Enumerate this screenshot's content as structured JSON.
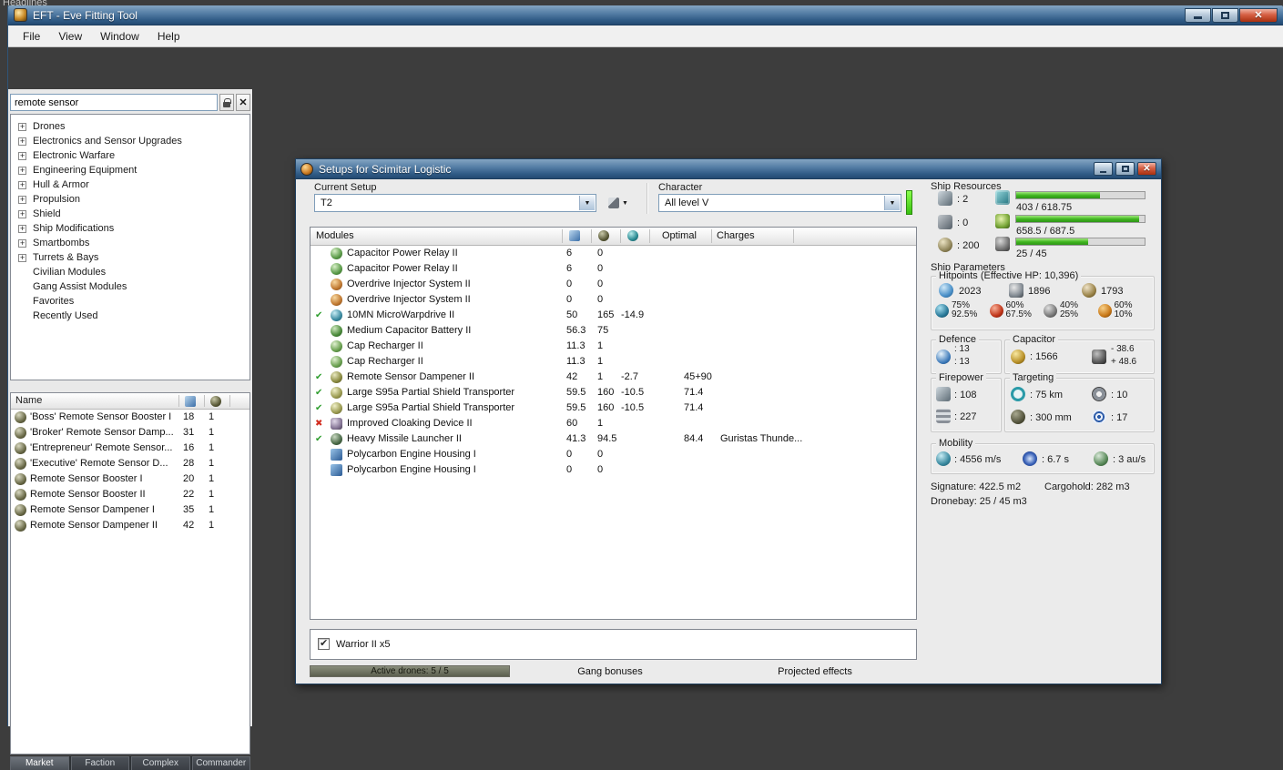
{
  "desktop": {
    "headlines": "Headlines"
  },
  "window": {
    "title": "EFT - Eve Fitting Tool",
    "menu": [
      {
        "label": "File"
      },
      {
        "label": "View"
      },
      {
        "label": "Window"
      },
      {
        "label": "Help"
      }
    ]
  },
  "sidebar": {
    "search": {
      "value": "remote sensor"
    },
    "tree": [
      {
        "label": "Drones",
        "expandable": true
      },
      {
        "label": "Electronics and Sensor Upgrades",
        "expandable": true
      },
      {
        "label": "Electronic Warfare",
        "expandable": true
      },
      {
        "label": "Engineering Equipment",
        "expandable": true
      },
      {
        "label": "Hull & Armor",
        "expandable": true
      },
      {
        "label": "Propulsion",
        "expandable": true
      },
      {
        "label": "Shield",
        "expandable": true
      },
      {
        "label": "Ship Modifications",
        "expandable": true
      },
      {
        "label": "Smartbombs",
        "expandable": true
      },
      {
        "label": "Turrets & Bays",
        "expandable": true
      },
      {
        "label": "Civilian Modules",
        "expandable": false
      },
      {
        "label": "Gang Assist Modules",
        "expandable": false
      },
      {
        "label": "Favorites",
        "expandable": false
      },
      {
        "label": "Recently Used",
        "expandable": false
      }
    ],
    "results": {
      "name_header": "Name",
      "rows": [
        {
          "name": "'Boss' Remote Sensor Booster I",
          "cpu": "18",
          "pg": "1"
        },
        {
          "name": "'Broker' Remote Sensor Damp...",
          "cpu": "31",
          "pg": "1"
        },
        {
          "name": "'Entrepreneur' Remote Sensor...",
          "cpu": "16",
          "pg": "1"
        },
        {
          "name": "'Executive' Remote Sensor D...",
          "cpu": "28",
          "pg": "1"
        },
        {
          "name": "Remote Sensor Booster I",
          "cpu": "20",
          "pg": "1"
        },
        {
          "name": "Remote Sensor Booster II",
          "cpu": "22",
          "pg": "1"
        },
        {
          "name": "Remote Sensor Dampener I",
          "cpu": "35",
          "pg": "1"
        },
        {
          "name": "Remote Sensor Dampener II",
          "cpu": "42",
          "pg": "1"
        }
      ]
    },
    "tabs": [
      {
        "label": "Market",
        "active": true
      },
      {
        "label": "Faction",
        "active": false
      },
      {
        "label": "Complex",
        "active": false
      },
      {
        "label": "Commander",
        "active": false
      }
    ]
  },
  "setup": {
    "title": "Setups for Scimitar Logistic",
    "current_setup_label": "Current Setup",
    "current_setup_value": "T2",
    "character_label": "Character",
    "character_value": "All level V",
    "columns": {
      "modules": "Modules",
      "optimal": "Optimal",
      "charges": "Charges"
    },
    "modules": [
      {
        "status": "none",
        "icon": "cap-relay",
        "name": "Capacitor Power Relay II",
        "pg": "6",
        "cpu": "0",
        "cap": "",
        "optimal": "",
        "charges": ""
      },
      {
        "status": "none",
        "icon": "cap-relay",
        "name": "Capacitor Power Relay II",
        "pg": "6",
        "cpu": "0",
        "cap": "",
        "optimal": "",
        "charges": ""
      },
      {
        "status": "none",
        "icon": "overdrive",
        "name": "Overdrive Injector System II",
        "pg": "0",
        "cpu": "0",
        "cap": "",
        "optimal": "",
        "charges": ""
      },
      {
        "status": "none",
        "icon": "overdrive",
        "name": "Overdrive Injector System II",
        "pg": "0",
        "cpu": "0",
        "cap": "",
        "optimal": "",
        "charges": ""
      },
      {
        "status": "active",
        "icon": "mwd",
        "name": "10MN MicroWarpdrive II",
        "pg": "50",
        "cpu": "165",
        "cap": "-14.9",
        "optimal": "",
        "charges": ""
      },
      {
        "status": "none",
        "icon": "cap-battery",
        "name": "Medium Capacitor Battery II",
        "pg": "56.3",
        "cpu": "75",
        "cap": "",
        "optimal": "",
        "charges": ""
      },
      {
        "status": "none",
        "icon": "cap-recharger",
        "name": "Cap Recharger II",
        "pg": "11.3",
        "cpu": "1",
        "cap": "",
        "optimal": "",
        "charges": ""
      },
      {
        "status": "none",
        "icon": "cap-recharger",
        "name": "Cap Recharger II",
        "pg": "11.3",
        "cpu": "1",
        "cap": "",
        "optimal": "",
        "charges": ""
      },
      {
        "status": "active",
        "icon": "sensor-damp",
        "name": "Remote Sensor Dampener II",
        "pg": "42",
        "cpu": "1",
        "cap": "-2.7",
        "optimal": "45+90",
        "charges": ""
      },
      {
        "status": "active",
        "icon": "shield-transporter",
        "name": "Large S95a Partial Shield Transporter",
        "pg": "59.5",
        "cpu": "160",
        "cap": "-10.5",
        "optimal": "71.4",
        "charges": ""
      },
      {
        "status": "active",
        "icon": "shield-transporter",
        "name": "Large S95a Partial Shield Transporter",
        "pg": "59.5",
        "cpu": "160",
        "cap": "-10.5",
        "optimal": "71.4",
        "charges": ""
      },
      {
        "status": "offline",
        "icon": "cloak",
        "name": "Improved Cloaking Device II",
        "pg": "60",
        "cpu": "1",
        "cap": "",
        "optimal": "",
        "charges": ""
      },
      {
        "status": "active",
        "icon": "missile-launcher",
        "name": "Heavy Missile Launcher II",
        "pg": "41.3",
        "cpu": "94.5",
        "cap": "",
        "optimal": "84.4",
        "charges": "Guristas Thunde..."
      },
      {
        "status": "none",
        "icon": "rig",
        "name": "Polycarbon Engine Housing I",
        "pg": "0",
        "cpu": "0",
        "cap": "",
        "optimal": "",
        "charges": ""
      },
      {
        "status": "none",
        "icon": "rig",
        "name": "Polycarbon Engine Housing I",
        "pg": "0",
        "cpu": "0",
        "cap": "",
        "optimal": "",
        "charges": ""
      }
    ],
    "drone_row": {
      "label": "Warrior II x5",
      "checked": true
    },
    "footer": {
      "active_drones": "Active drones: 5 / 5",
      "active_drones_pct": 100,
      "gang_bonuses": "Gang bonuses",
      "projected_effects": "Projected effects"
    }
  },
  "stats": {
    "resources_title": "Ship Resources",
    "turrets": ": 2",
    "launchers": ": 0",
    "calibration": ": 200",
    "cpu": {
      "text": "403 / 618.75",
      "pct": 65
    },
    "powergrid": {
      "text": "658.5 / 687.5",
      "pct": 96
    },
    "dronebay_bar": {
      "text": "25 / 45",
      "pct": 56
    },
    "parameters_title": "Ship Parameters",
    "hitpoints": {
      "title": "Hitpoints (Effective HP: 10,396)",
      "shield": "2023",
      "armor": "1896",
      "hull": "1793",
      "resists": [
        {
          "icon": "em",
          "top": "75%",
          "bottom": "92.5%"
        },
        {
          "icon": "thermal",
          "top": "60%",
          "bottom": "67.5%"
        },
        {
          "icon": "kinetic",
          "top": "40%",
          "bottom": "25%"
        },
        {
          "icon": "explosive",
          "top": "60%",
          "bottom": "10%"
        }
      ]
    },
    "defence": {
      "title": "Defence",
      "value1": ": 13",
      "value2": ": 13"
    },
    "capacitor": {
      "title": "Capacitor",
      "amount": ": 1566",
      "drain": "- 38.6",
      "recharge": "+ 48.6"
    },
    "firepower": {
      "title": "Firepower",
      "turret_dps": ": 108",
      "missile_dps": ": 227"
    },
    "targeting": {
      "title": "Targeting",
      "range": ": 75 km",
      "max_targets": ": 10",
      "resolution": ": 300 mm",
      "sensor_strength": ": 17"
    },
    "mobility": {
      "title": "Mobility",
      "speed": ": 4556 m/s",
      "align": ": 6.7 s",
      "warp": ": 3 au/s"
    },
    "signature": "Signature: 422.5 m2",
    "cargohold": "Cargohold: 282 m3",
    "dronebay": "Dronebay: 25 / 45 m3"
  }
}
